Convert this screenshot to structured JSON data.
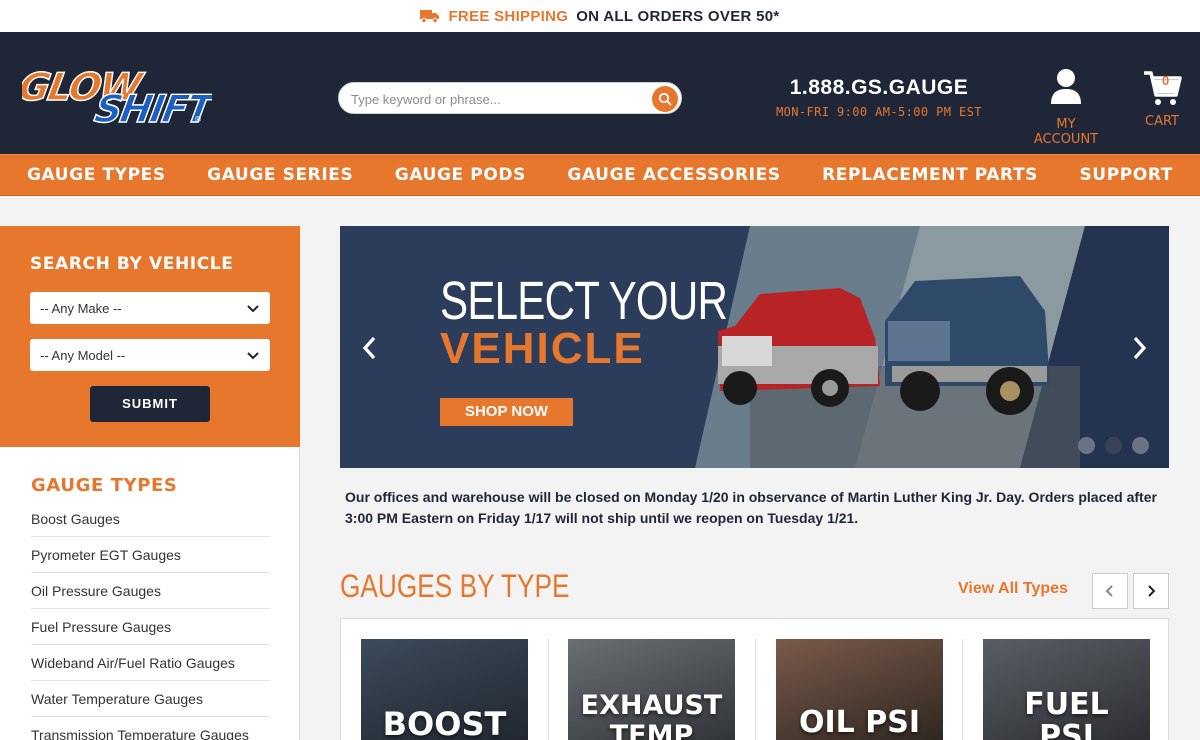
{
  "promo": {
    "highlight": "FREE SHIPPING",
    "rest": "ON ALL ORDERS OVER 50*"
  },
  "header": {
    "logo_text": "GLOWSHIFT",
    "search_placeholder": "Type keyword or phrase...",
    "phone": "1.888.GS.GAUGE",
    "hours": "MON-FRI 9:00 AM-5:00 PM EST",
    "account_label": "MY ACCOUNT",
    "cart_label": "CART",
    "cart_count": "0"
  },
  "nav": [
    "GAUGE TYPES",
    "GAUGE SERIES",
    "GAUGE PODS",
    "GAUGE ACCESSORIES",
    "REPLACEMENT PARTS",
    "SUPPORT"
  ],
  "vehicle_search": {
    "title": "SEARCH BY VEHICLE",
    "make": "-- Any Make --",
    "model": "-- Any Model --",
    "submit": "SUBMIT"
  },
  "sidebar_types": {
    "title": "GAUGE TYPES",
    "items": [
      "Boost Gauges",
      "Pyrometer EGT Gauges",
      "Oil Pressure Gauges",
      "Fuel Pressure Gauges",
      "Wideband Air/Fuel Ratio Gauges",
      "Water Temperature Gauges",
      "Transmission Temperature Gauges"
    ]
  },
  "hero": {
    "line1": "SELECT YOUR",
    "line2": "VEHICLE",
    "cta": "SHOP NOW"
  },
  "notice": "Our offices and warehouse will be closed on Monday 1/20 in observance of Martin Luther King Jr. Day. Orders placed after 3:00 PM Eastern on Friday 1/17 will not ship until we reopen on Tuesday 1/21.",
  "section": {
    "title": "GAUGES BY TYPE",
    "view_all": "View All Types",
    "cards": [
      "BOOST",
      "EXHAUST TEMP",
      "OIL PSI",
      "FUEL PSI"
    ]
  },
  "colors": {
    "orange": "#e8772e",
    "navy": "#1e2638"
  }
}
